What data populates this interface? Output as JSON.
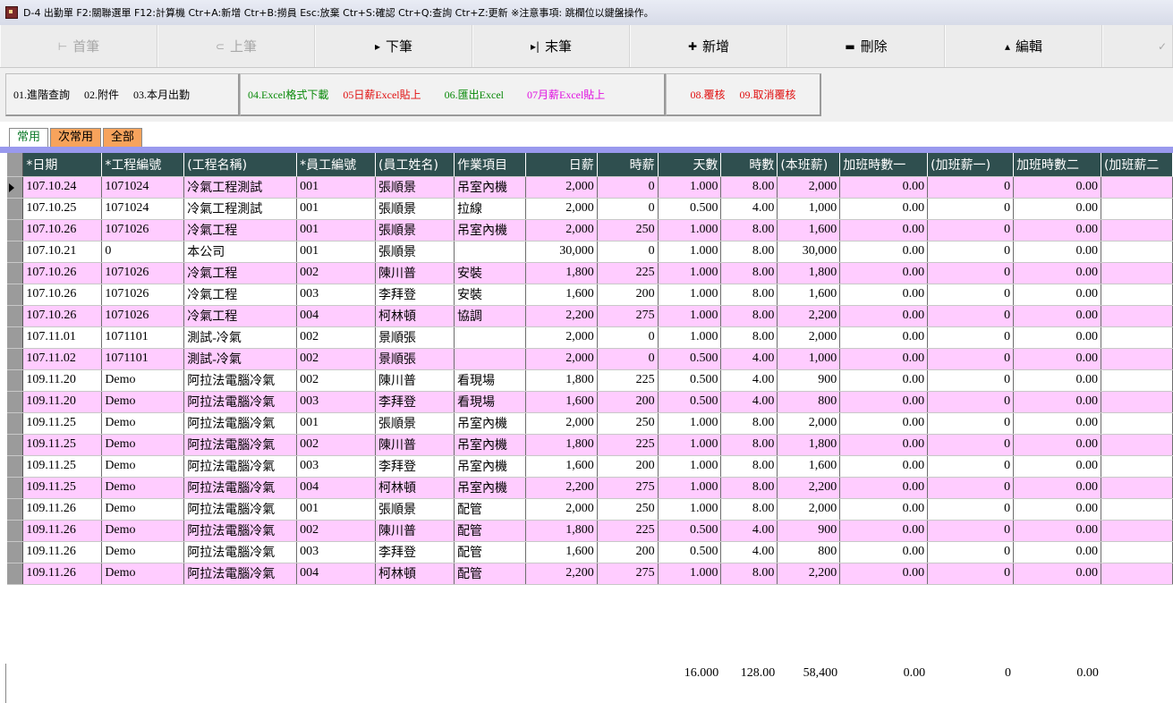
{
  "titlebar": {
    "text": "D-4 出勤單  F2:關聯選單  F12:計算機  Ctr+A:新增  Ctr+B:撈員  Esc:放棄  Ctr+S:確認  Ctr+Q:查詢  Ctr+Z:更新  ※注意事項: 跳欄位以鍵盤操作。"
  },
  "nav": {
    "first": "首筆",
    "prev": "上筆",
    "next": "下筆",
    "last": "末筆",
    "add": "新增",
    "delete": "刪除",
    "edit": "編輯",
    "first_icon": "⊢",
    "prev_icon": "⊂",
    "next_icon": "▸",
    "last_icon": "▸|",
    "add_icon": "✚",
    "delete_icon": "▬",
    "edit_icon": "▴",
    "more_icon": "✓"
  },
  "functions": {
    "group1": [
      "01.進階查詢",
      "02.附件",
      "03.本月出勤"
    ],
    "group2": [
      "04.Excel格式下載",
      "05日薪Excel貼上",
      "06.匯出Excel",
      "07月薪Excel貼上"
    ],
    "group3": [
      "08.覆核",
      "09.取消覆核"
    ],
    "colors": {
      "black": "#000000",
      "green": "#0a8a0a",
      "red": "#e01010",
      "magenta": "#e010e0"
    }
  },
  "tabs": [
    "常用",
    "次常用",
    "全部"
  ],
  "grid": {
    "headers": [
      "*日期",
      "*工程編號",
      "(工程名稱)",
      "*員工編號",
      "(員工姓名)",
      "作業項目",
      "日薪",
      "時薪",
      "天數",
      "時數",
      "(本班薪)",
      "加班時數一",
      "(加班薪一)",
      "加班時數二",
      "(加班薪二"
    ],
    "rows": [
      [
        "107.10.24",
        "1071024",
        "冷氣工程測試",
        "001",
        "張順景",
        "吊室內機",
        "2,000",
        "0",
        "1.000",
        "8.00",
        "2,000",
        "0.00",
        "0",
        "0.00",
        ""
      ],
      [
        "107.10.25",
        "1071024",
        "冷氣工程測試",
        "001",
        "張順景",
        "拉線",
        "2,000",
        "0",
        "0.500",
        "4.00",
        "1,000",
        "0.00",
        "0",
        "0.00",
        ""
      ],
      [
        "107.10.26",
        "1071026",
        "冷氣工程",
        "001",
        "張順景",
        "吊室內機",
        "2,000",
        "250",
        "1.000",
        "8.00",
        "1,600",
        "0.00",
        "0",
        "0.00",
        ""
      ],
      [
        "107.10.21",
        "0",
        "本公司",
        "001",
        "張順景",
        "",
        "30,000",
        "0",
        "1.000",
        "8.00",
        "30,000",
        "0.00",
        "0",
        "0.00",
        ""
      ],
      [
        "107.10.26",
        "1071026",
        "冷氣工程",
        "002",
        "陳川普",
        "安裝",
        "1,800",
        "225",
        "1.000",
        "8.00",
        "1,800",
        "0.00",
        "0",
        "0.00",
        ""
      ],
      [
        "107.10.26",
        "1071026",
        "冷氣工程",
        "003",
        "李拜登",
        "安裝",
        "1,600",
        "200",
        "1.000",
        "8.00",
        "1,600",
        "0.00",
        "0",
        "0.00",
        ""
      ],
      [
        "107.10.26",
        "1071026",
        "冷氣工程",
        "004",
        "柯林頓",
        "協調",
        "2,200",
        "275",
        "1.000",
        "8.00",
        "2,200",
        "0.00",
        "0",
        "0.00",
        ""
      ],
      [
        "107.11.01",
        "1071101",
        "測試-冷氣",
        "002",
        "景順張",
        "",
        "2,000",
        "0",
        "1.000",
        "8.00",
        "2,000",
        "0.00",
        "0",
        "0.00",
        ""
      ],
      [
        "107.11.02",
        "1071101",
        "測試-冷氣",
        "002",
        "景順張",
        "",
        "2,000",
        "0",
        "0.500",
        "4.00",
        "1,000",
        "0.00",
        "0",
        "0.00",
        ""
      ],
      [
        "109.11.20",
        "Demo",
        "阿拉法電腦冷氣",
        "002",
        "陳川普",
        "看現場",
        "1,800",
        "225",
        "0.500",
        "4.00",
        "900",
        "0.00",
        "0",
        "0.00",
        ""
      ],
      [
        "109.11.20",
        "Demo",
        "阿拉法電腦冷氣",
        "003",
        "李拜登",
        "看現場",
        "1,600",
        "200",
        "0.500",
        "4.00",
        "800",
        "0.00",
        "0",
        "0.00",
        ""
      ],
      [
        "109.11.25",
        "Demo",
        "阿拉法電腦冷氣",
        "001",
        "張順景",
        "吊室內機",
        "2,000",
        "250",
        "1.000",
        "8.00",
        "2,000",
        "0.00",
        "0",
        "0.00",
        ""
      ],
      [
        "109.11.25",
        "Demo",
        "阿拉法電腦冷氣",
        "002",
        "陳川普",
        "吊室內機",
        "1,800",
        "225",
        "1.000",
        "8.00",
        "1,800",
        "0.00",
        "0",
        "0.00",
        ""
      ],
      [
        "109.11.25",
        "Demo",
        "阿拉法電腦冷氣",
        "003",
        "李拜登",
        "吊室內機",
        "1,600",
        "200",
        "1.000",
        "8.00",
        "1,600",
        "0.00",
        "0",
        "0.00",
        ""
      ],
      [
        "109.11.25",
        "Demo",
        "阿拉法電腦冷氣",
        "004",
        "柯林頓",
        "吊室內機",
        "2,200",
        "275",
        "1.000",
        "8.00",
        "2,200",
        "0.00",
        "0",
        "0.00",
        ""
      ],
      [
        "109.11.26",
        "Demo",
        "阿拉法電腦冷氣",
        "001",
        "張順景",
        "配管",
        "2,000",
        "250",
        "1.000",
        "8.00",
        "2,000",
        "0.00",
        "0",
        "0.00",
        ""
      ],
      [
        "109.11.26",
        "Demo",
        "阿拉法電腦冷氣",
        "002",
        "陳川普",
        "配管",
        "1,800",
        "225",
        "0.500",
        "4.00",
        "900",
        "0.00",
        "0",
        "0.00",
        ""
      ],
      [
        "109.11.26",
        "Demo",
        "阿拉法電腦冷氣",
        "003",
        "李拜登",
        "配管",
        "1,600",
        "200",
        "0.500",
        "4.00",
        "800",
        "0.00",
        "0",
        "0.00",
        ""
      ],
      [
        "109.11.26",
        "Demo",
        "阿拉法電腦冷氣",
        "004",
        "柯林頓",
        "配管",
        "2,200",
        "275",
        "1.000",
        "8.00",
        "2,200",
        "0.00",
        "0",
        "0.00",
        ""
      ]
    ],
    "totals": [
      "",
      "",
      "",
      "",
      "",
      "",
      "",
      "",
      "16.000",
      "128.00",
      "58,400",
      "0.00",
      "0",
      "0.00",
      ""
    ],
    "row_colors": {
      "odd": "#ffccff",
      "even": "#ffffff",
      "header": "#2f4f4f"
    }
  }
}
